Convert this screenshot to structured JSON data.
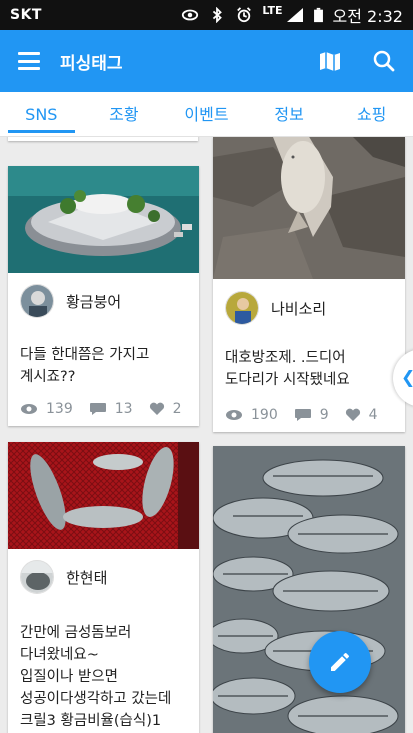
{
  "status_bar": {
    "carrier": "SKT",
    "network": "LTE",
    "time": "오전 2:32"
  },
  "app_bar": {
    "title": "피싱태그",
    "icons": [
      "menu-icon",
      "map-icon",
      "search-icon"
    ]
  },
  "tabs": [
    {
      "label": "SNS",
      "active": true
    },
    {
      "label": "조황",
      "active": false
    },
    {
      "label": "이벤트",
      "active": false
    },
    {
      "label": "정보",
      "active": false
    },
    {
      "label": "쇼핑",
      "active": false
    }
  ],
  "posts": [
    {
      "author": "황금붕어",
      "text": "다들 한대쯤은 가지고\n계시죠??",
      "views": "139",
      "comments": "13",
      "likes": "2"
    },
    {
      "author": "나비소리",
      "text": "대호방조제. .드디어\n도다리가 시작됐네요",
      "views": "190",
      "comments": "9",
      "likes": "4"
    },
    {
      "author": "한현태",
      "text": "간만에 금성돔보러\n다녀왔네요~\n입질이나 받으면\n성공이다생각하고 갔는데\n크릴3  황금비율(습식)1"
    }
  ],
  "colors": {
    "primary": "#2196f3",
    "status_bar": "#111111",
    "background": "#ececec",
    "stat_gray": "#8a9299"
  }
}
